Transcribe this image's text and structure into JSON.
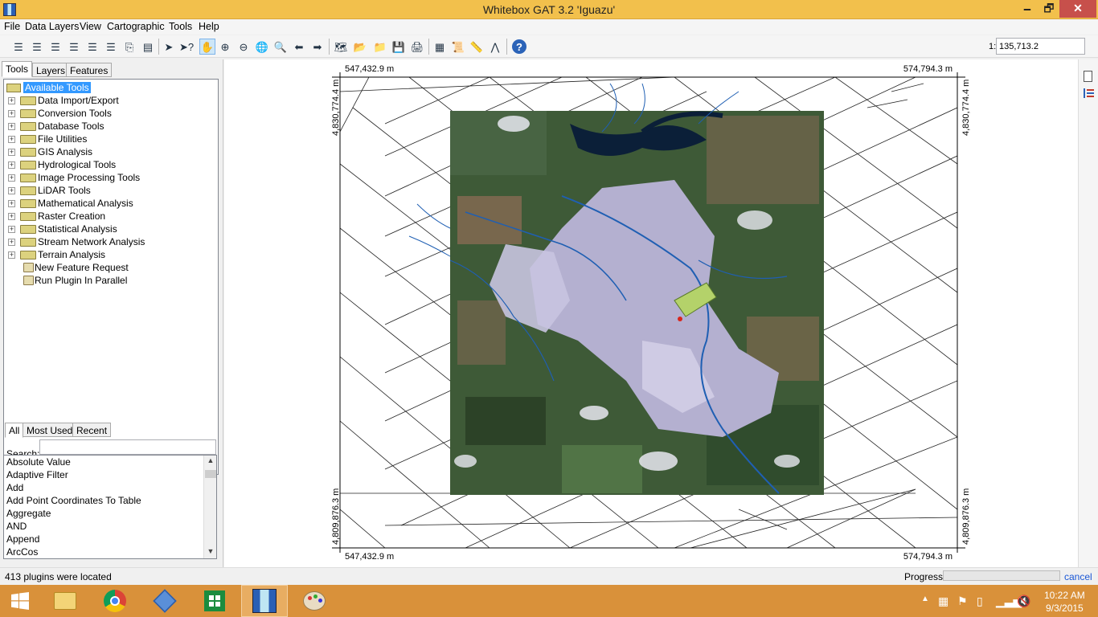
{
  "window": {
    "title": "Whitebox GAT 3.2 'Iguazu'",
    "minimize": "🗕",
    "maximize": "🗗",
    "close": "✕"
  },
  "menu": [
    "File",
    "Data Layers",
    "View",
    "Cartographic",
    "Tools",
    "Help"
  ],
  "toolbar": {
    "icons": [
      "add-layer-icon",
      "remove-layer-icon",
      "layer-up-icon",
      "layer-down-icon",
      "layer-top-icon",
      "layer-bottom-icon",
      "layer-properties-icon",
      "select-icon",
      "select-feature-icon",
      "pan-icon",
      "zoom-in-icon",
      "zoom-out-icon",
      "full-extent-icon",
      "zoom-to-layer-icon",
      "previous-extent-icon",
      "next-extent-icon",
      "new-map-icon",
      "open-map-icon",
      "open-folder-icon",
      "save-icon",
      "print-icon",
      "raster-calculator-icon",
      "scripter-icon",
      "measure-icon",
      "profile-icon",
      "help-icon"
    ],
    "active": "pan-icon",
    "scale_prefix": "1:",
    "scale_value": "135,713.2"
  },
  "left_panel": {
    "tabs": [
      "Tools",
      "Layers",
      "Features"
    ],
    "selected_tab": "Tools",
    "tree": {
      "root": "Available Tools",
      "folders": [
        "Data Import/Export",
        "Conversion Tools",
        "Database Tools",
        "File Utilities",
        "GIS Analysis",
        "Hydrological Tools",
        "Image Processing Tools",
        "LiDAR Tools",
        "Mathematical Analysis",
        "Raster Creation",
        "Statistical Analysis",
        "Stream Network Analysis",
        "Terrain Analysis"
      ],
      "tools": [
        "New Feature Request",
        "Run Plugin In Parallel"
      ]
    },
    "lower_tabs": [
      "All",
      "Most Used",
      "Recent"
    ],
    "selected_lower_tab": "All",
    "search_label": "Search:",
    "search_value": "",
    "list_items": [
      "Absolute Value",
      "Adaptive Filter",
      "Add",
      "Add Point Coordinates To Table",
      "Aggregate",
      "AND",
      "Append",
      "ArcCos"
    ]
  },
  "map": {
    "top_left_x": "547,432.9 m",
    "top_right_x": "574,794.3 m",
    "bottom_left_x": "547,432.9 m",
    "bottom_right_x": "574,794.3 m",
    "left_top_y": "4,830,774.4 m",
    "left_bottom_y": "4,809,876.3 m",
    "right_top_y": "4,830,774.4 m",
    "right_bottom_y": "4,809,876.3 m",
    "image_colors": {
      "urban": "#b4b0d0",
      "vegetation": "#3e5a37",
      "bare": "#a0705c",
      "river": "#1f5fb3",
      "lake": "#0b1f38",
      "highlight": "#b4d26a",
      "marker": "#d9251c"
    }
  },
  "right_strip": {
    "icons": [
      "new-document-icon",
      "legend-icon"
    ]
  },
  "status": {
    "message": "413 plugins were located",
    "progress_label": "Progress",
    "progress_fraction": 0,
    "cancel": "cancel"
  },
  "taskbar": {
    "apps": [
      "start-icon",
      "file-explorer-icon",
      "chrome-icon",
      "virtualbox-icon",
      "store-icon",
      "whitebox-icon",
      "paint-icon"
    ],
    "active": "whitebox-icon",
    "time": "10:22 AM",
    "date": "9/3/2015"
  }
}
